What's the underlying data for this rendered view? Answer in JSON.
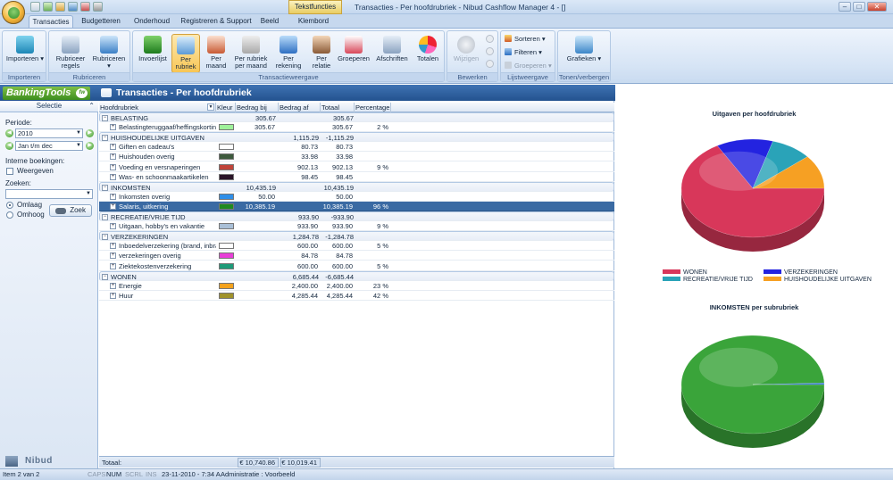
{
  "window": {
    "context_tab": "Tekstfuncties",
    "title": "Transacties - Per hoofdrubriek - Nibud Cashflow Manager 4 - []",
    "controls": [
      "–",
      "□",
      "✕"
    ]
  },
  "tabs": [
    "Transacties",
    "Budgetteren",
    "Onderhoud",
    "Registreren & Support",
    "Beeld",
    "Klembord"
  ],
  "ribbon": {
    "groups": {
      "importeren": "Importeren",
      "rubriceren": "Rubriceren",
      "transactieweergave": "Transactieweergave",
      "bewerken": "Bewerken",
      "lijstweergave": "Lijstweergave",
      "tonen": "Tonen/verbergen"
    },
    "buttons": {
      "importeren": "Importeren",
      "rubriceer_regels_1": "Rubriceer",
      "rubriceer_regels_2": "regels",
      "rubriceren": "Rubriceren",
      "invoerlijst": "Invoerlijst",
      "per_rubriek_1": "Per",
      "per_rubriek_2": "rubriek",
      "per_maand_1": "Per",
      "per_maand_2": "maand",
      "per_rubriek_per_maand_1": "Per rubriek",
      "per_rubriek_per_maand_2": "per maand",
      "per_rekening_1": "Per",
      "per_rekening_2": "rekening",
      "per_relatie_1": "Per",
      "per_relatie_2": "relatie",
      "groeperen": "Groeperen",
      "afschriften": "Afschriften",
      "totalen": "Totalen",
      "wijzigen": "Wijzigen",
      "sorteren": "Sorteren",
      "filteren": "Filteren",
      "groeperen_small": "Groeperen",
      "grafieken": "Grafieken"
    }
  },
  "header": {
    "logo": "BankingTools",
    "logo_badge": "fw",
    "title": "Transacties - Per hoofdrubriek"
  },
  "selection": {
    "title": "Selectie",
    "periode_label": "Periode:",
    "year": "2010",
    "range": "Jan t/m dec",
    "interne_label": "Interne boekingen:",
    "weergeven": "Weergeven",
    "zoeken_label": "Zoeken:",
    "zoeken_value": "",
    "omlaag": "Omlaag",
    "omhoog": "Omhoog",
    "zoek_button": "Zoek",
    "footer_logo": "Nibud"
  },
  "grid": {
    "columns": [
      "Hoofdrubriek",
      "Kleur",
      "Bedrag bij",
      "Bedrag af",
      "Totaal",
      "Percentage"
    ],
    "rows": [
      {
        "type": "group",
        "name": "BELASTING",
        "bij": "305.67",
        "af": "",
        "totaal": "305.67",
        "pct": ""
      },
      {
        "type": "item",
        "name": "Belastingteruggaaf/heffingskortingen",
        "color": "#9ff29a",
        "bij": "305.67",
        "af": "",
        "totaal": "305.67",
        "pct": "2 %"
      },
      {
        "type": "group",
        "name": "HUISHOUDELIJKE UITGAVEN",
        "bij": "",
        "af": "1,115.29",
        "totaal": "-1,115.29",
        "pct": ""
      },
      {
        "type": "item",
        "name": "Giften en cadeau's",
        "color": "#ffffff",
        "bij": "",
        "af": "80.73",
        "totaal": "80.73",
        "pct": ""
      },
      {
        "type": "item",
        "name": "Huishouden overig",
        "color": "#3d5a3d",
        "bij": "",
        "af": "33.98",
        "totaal": "33.98",
        "pct": ""
      },
      {
        "type": "item",
        "name": "Voeding en versnaperingen",
        "color": "#c0443a",
        "bij": "",
        "af": "902.13",
        "totaal": "902.13",
        "pct": "9 %"
      },
      {
        "type": "item",
        "name": "Was- en schoonmaakartikelen",
        "color": "#2a1428",
        "bij": "",
        "af": "98.45",
        "totaal": "98.45",
        "pct": ""
      },
      {
        "type": "group",
        "name": "INKOMSTEN",
        "bij": "10,435.19",
        "af": "",
        "totaal": "10,435.19",
        "pct": ""
      },
      {
        "type": "item",
        "name": "Inkomsten overig",
        "color": "#2f8fe8",
        "bij": "50.00",
        "af": "",
        "totaal": "50.00",
        "pct": ""
      },
      {
        "type": "item",
        "name": "Salaris, uitkering",
        "color": "#1f8a1f",
        "bij": "10,385.19",
        "af": "",
        "totaal": "10,385.19",
        "pct": "96 %",
        "selected": true
      },
      {
        "type": "group",
        "name": "RECREATIE/VRIJE TIJD",
        "bij": "",
        "af": "933.90",
        "totaal": "-933.90",
        "pct": ""
      },
      {
        "type": "item",
        "name": "Uitgaan, hobby's en vakantie",
        "color": "#a9bfd6",
        "bij": "",
        "af": "933.90",
        "totaal": "933.90",
        "pct": "9 %"
      },
      {
        "type": "group",
        "name": "VERZEKERINGEN",
        "bij": "",
        "af": "1,284.78",
        "totaal": "-1,284.78",
        "pct": ""
      },
      {
        "type": "item",
        "name": "Inboedelverzekering (brand, inbraak",
        "color": "#ffffff",
        "bij": "",
        "af": "600.00",
        "totaal": "600.00",
        "pct": "5 %"
      },
      {
        "type": "item",
        "name": "verzekeringen overig",
        "color": "#e83ed8",
        "bij": "",
        "af": "84.78",
        "totaal": "84.78",
        "pct": ""
      },
      {
        "type": "item",
        "name": "Ziektekostenverzekering",
        "color": "#1d9a78",
        "bij": "",
        "af": "600.00",
        "totaal": "600.00",
        "pct": "5 %"
      },
      {
        "type": "group",
        "name": "WONEN",
        "bij": "",
        "af": "6,685.44",
        "totaal": "-6,685.44",
        "pct": ""
      },
      {
        "type": "item",
        "name": "Energie",
        "color": "#f3a21c",
        "bij": "",
        "af": "2,400.00",
        "totaal": "2,400.00",
        "pct": "23 %"
      },
      {
        "type": "item",
        "name": "Huur",
        "color": "#a0922a",
        "bij": "",
        "af": "4,285.44",
        "totaal": "4,285.44",
        "pct": "42 %"
      }
    ],
    "totals": {
      "label": "Totaal:",
      "bij": "€ 10,740.86",
      "af": "€ 10,019.41"
    }
  },
  "chart_data": [
    {
      "type": "pie",
      "title": "Uitgaven per hoofdrubriek",
      "slices": [
        {
          "name": "WONEN",
          "value": 6685.44,
          "color": "#d8375a"
        },
        {
          "name": "VERZEKERINGEN",
          "value": 1284.78,
          "color": "#2323e0"
        },
        {
          "name": "RECREATIE/VRIJE TIJD",
          "value": 933.9,
          "color": "#2aa3b8"
        },
        {
          "name": "HUISHOUDELIJKE UITGAVEN",
          "value": 1115.29,
          "color": "#f6a023"
        }
      ],
      "legend": "bottom"
    },
    {
      "type": "pie",
      "title": "INKOMSTEN per subrubriek",
      "slices": [
        {
          "name": "Salaris, uitkering",
          "value": 10385.19,
          "color": "#3aa43a"
        },
        {
          "name": "Inkomsten overig",
          "value": 50.0,
          "color": "#2f6fe8"
        }
      ]
    }
  ],
  "status": {
    "items": "Item 2 van 2",
    "caps": "CAPS",
    "num": "NUM",
    "scrl": "SCRL",
    "ins": "INS",
    "datetime": "23-11-2010 - 7:34 A",
    "admin": "Administratie : Voorbeeld"
  }
}
